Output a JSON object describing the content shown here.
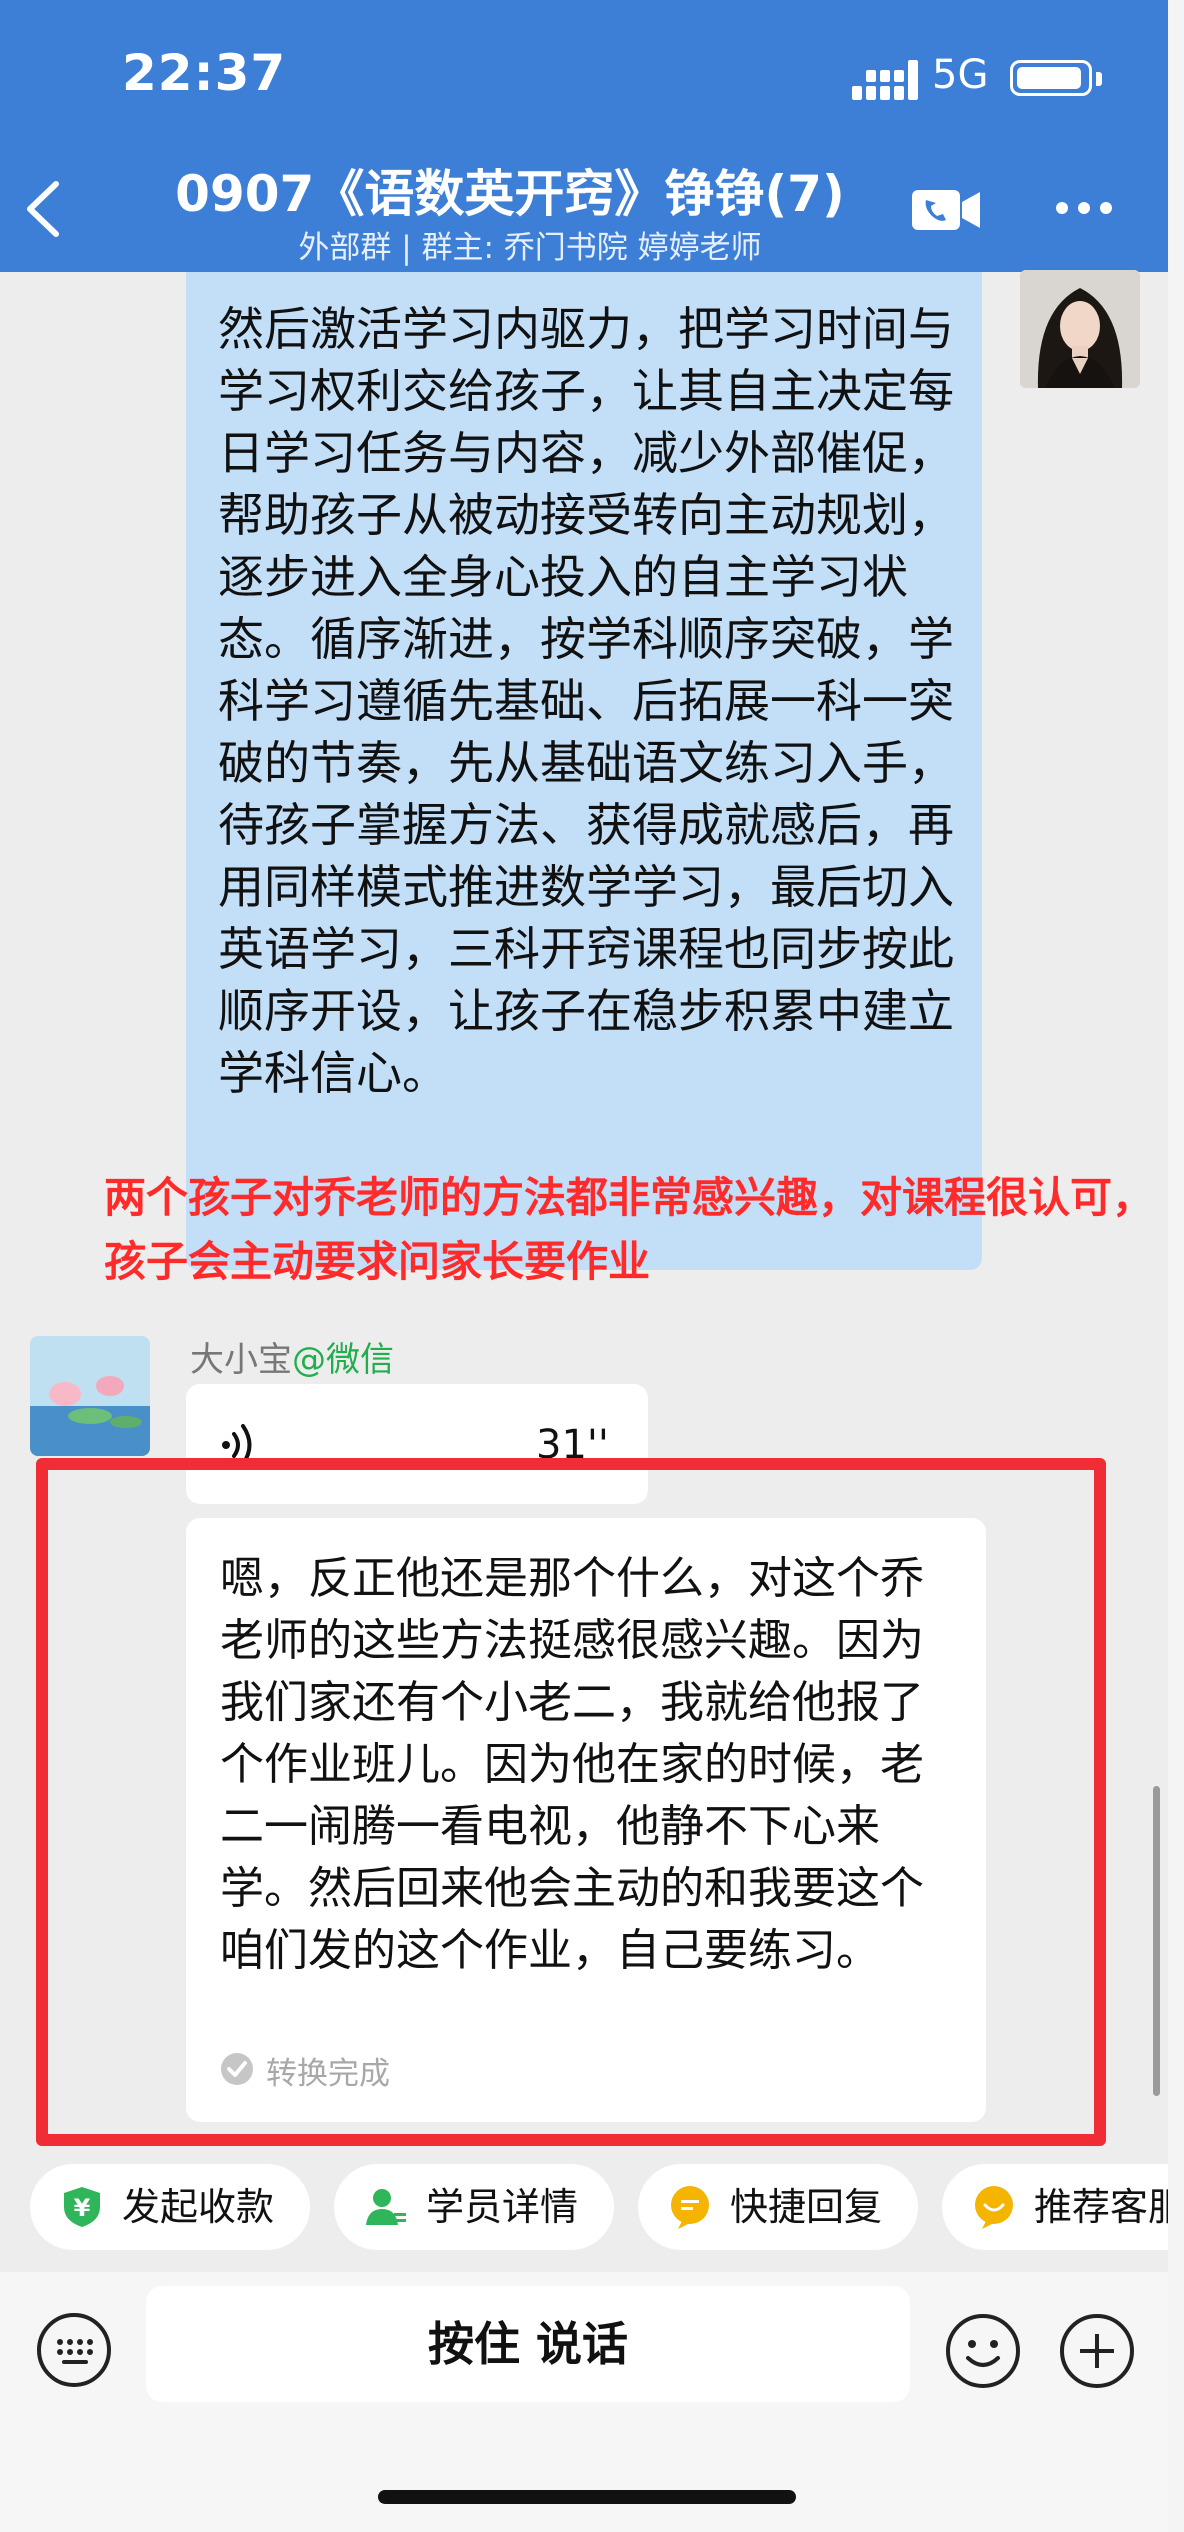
{
  "status_bar": {
    "time": "22:37",
    "network": "5G"
  },
  "header": {
    "title": "0907《语数英开窍》铮铮(7)",
    "subtitle": "外部群 | 群主: 乔门书院 婷婷老师"
  },
  "messages": {
    "teacher_text": "然后激活学习内驱力，把学习时间与学习权利交给孩子，让其自主决定每日学习任务与内容，减少外部催促，帮助孩子从被动接受转向主动规划，逐步进入全身心投入的自主学习状态。循序渐进，按学科顺序突破，学科学习遵循先基础、后拓展一科一突破的节奏，先从基础语文练习入手，待孩子掌握方法、获得成就感后，再用同样模式推进数学学习，最后切入英语学习，三科开窍课程也同步按此顺序开设，让孩子在稳步积累中建立学科信心。",
    "annotation": "两个孩子对乔老师的方法都非常感兴趣，对课程很认可，孩子会主动要求问家长要作业",
    "parent": {
      "name": "大小宝",
      "source": "@微信",
      "voice_duration": "31''",
      "transcript": "嗯，反正他还是那个什么，对这个乔老师的这些方法挺感很感兴趣。因为我们家还有个小老二，我就给他报了个作业班儿。因为他在家的时候，老二一闹腾一看电视，他静不下心来学。然后回来他会主动的和我要这个咱们发的这个作业，自己要练习。",
      "transcript_status": "转换完成"
    }
  },
  "quick_actions": [
    {
      "label": "发起收款",
      "icon": "payment-icon",
      "color": "#2fb55a"
    },
    {
      "label": "学员详情",
      "icon": "student-icon",
      "color": "#2fb55a"
    },
    {
      "label": "快捷回复",
      "icon": "quick-reply-icon",
      "color": "#f5b400"
    },
    {
      "label": "推荐客服",
      "icon": "recommend-icon",
      "color": "#f5b400"
    }
  ],
  "input_bar": {
    "hold_to_talk": "按住 说话"
  },
  "colors": {
    "header": "#3d7fd6",
    "teacher_bubble": "#c3dff8",
    "annotation": "#ff2b2b",
    "highlight": "#f02c34"
  }
}
